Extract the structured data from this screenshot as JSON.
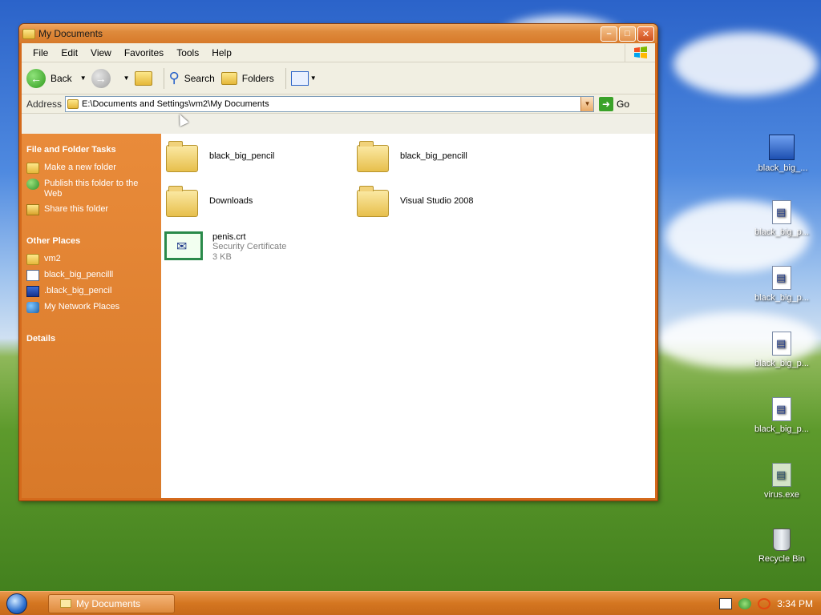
{
  "window": {
    "title": "My Documents",
    "menu": [
      "File",
      "Edit",
      "View",
      "Favorites",
      "Tools",
      "Help"
    ],
    "toolbar": {
      "back": "Back",
      "search": "Search",
      "folders": "Folders"
    },
    "address": {
      "label": "Address",
      "value": "E:\\Documents and Settings\\vm2\\My Documents",
      "go": "Go"
    },
    "taskpane": {
      "file_tasks_title": "File and Folder Tasks",
      "file_tasks": [
        "Make a new folder",
        "Publish this folder to the Web",
        "Share this folder"
      ],
      "other_places_title": "Other Places",
      "other_places": [
        "vm2",
        "black_big_pencilll",
        ".black_big_pencil",
        "My Network Places"
      ],
      "details_title": "Details"
    },
    "files": [
      {
        "name": "black_big_pencil"
      },
      {
        "name": "black_big_pencill"
      },
      {
        "name": "Downloads"
      },
      {
        "name": "Visual Studio 2008"
      },
      {
        "name": "penis.crt",
        "type": "Security Certificate",
        "size": "3 KB"
      }
    ]
  },
  "desktop": {
    "icons": [
      ".black_big_...",
      "black_big_p...",
      "black_big_p...",
      "black_big_p...",
      "black_big_p...",
      "virus.exe",
      "Recycle Bin"
    ]
  },
  "taskbar": {
    "task": "My Documents",
    "time": "3:34 PM"
  }
}
